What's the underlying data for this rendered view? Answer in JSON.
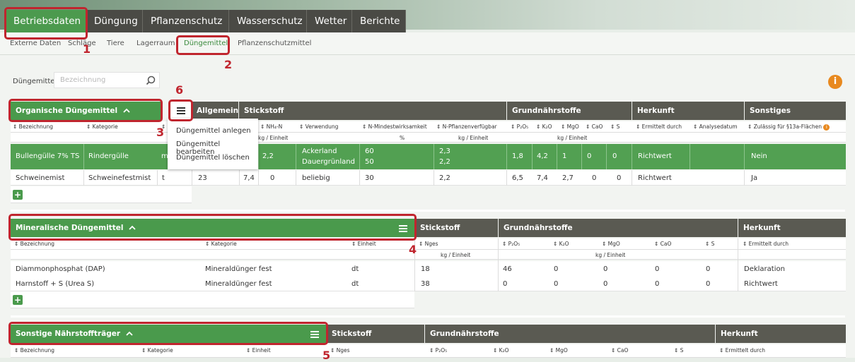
{
  "main_tabs": [
    "Betriebsdaten",
    "Düngung",
    "Pflanzenschutz",
    "Wasserschutz",
    "Wetter",
    "Berichte"
  ],
  "sub_tabs": [
    "Externe Daten",
    "Schläge",
    "Tiere",
    "Lagerraum",
    "Düngemittel",
    "Pflanzenschutzmittel"
  ],
  "search": {
    "label": "Düngemittel",
    "placeholder": "Bezeichnung"
  },
  "info_label": "i",
  "menu": [
    "Düngemittel anlegen",
    "Düngemittel bearbeiten",
    "Düngemittel löschen"
  ],
  "annotations": [
    "1",
    "2",
    "3",
    "4",
    "5",
    "6"
  ],
  "organic": {
    "title": "Organische Düngemittel",
    "groups": [
      "Allgemein",
      "Stickstoff",
      "Grundnährstoffe",
      "Herkunft",
      "Sonstiges"
    ],
    "cols": [
      "Bezeichnung",
      "Kategorie",
      "E",
      "es",
      "NH₄-N",
      "Verwendung",
      "N-Mindestwirksamkeit",
      "N-Pflanzenverfügbar",
      "P₂O₅",
      "K₂O",
      "MgO",
      "CaO",
      "S",
      "Ermittelt durch",
      "Analysedatum",
      "Zulässig für §13a-Flächen"
    ],
    "units": [
      "kg / Einheit",
      "%",
      "kg / Einheit",
      "kg / Einheit"
    ],
    "rows": [
      [
        "Bullengülle 7% TS",
        "Rindergülle",
        "m³",
        "2,2",
        "Ackerland",
        "Dauergrünland",
        "60",
        "50",
        "2,3",
        "2,2",
        "1,8",
        "4,2",
        "1",
        "0",
        "0",
        "Richtwert",
        "Nein"
      ],
      [
        "Schweinemist",
        "Schweinefestmist",
        "t",
        "23",
        "7,4",
        "0",
        "beliebig",
        "30",
        "2,2",
        "6,5",
        "7,4",
        "2,7",
        "0",
        "0",
        "Richtwert",
        "Ja"
      ]
    ]
  },
  "mineral": {
    "title": "Mineralische Düngemittel",
    "groups": [
      "Stickstoff",
      "Grundnährstoffe",
      "Herkunft"
    ],
    "cols": [
      "Bezeichnung",
      "Kategorie",
      "Einheit",
      "Nges",
      "P₂O₅",
      "K₂O",
      "MgO",
      "CaO",
      "S",
      "Ermittelt durch"
    ],
    "units": [
      "kg / Einheit",
      "kg / Einheit"
    ],
    "rows": [
      [
        "Diammonphosphat (DAP)",
        "Mineraldünger fest",
        "dt",
        "18",
        "46",
        "0",
        "0",
        "0",
        "0",
        "Deklaration"
      ],
      [
        "Harnstoff + S (Urea S)",
        "Mineraldünger fest",
        "dt",
        "38",
        "0",
        "0",
        "0",
        "0",
        "0",
        "Richtwert"
      ]
    ]
  },
  "other": {
    "title": "Sonstige Nährstoffträger",
    "groups": [
      "Stickstoff",
      "Grundnährstoffe",
      "Herkunft"
    ],
    "cols": [
      "Bezeichnung",
      "Kategorie",
      "Einheit",
      "Nges",
      "P₂O₅",
      "K₂O",
      "MgO",
      "CaO",
      "S",
      "Ermittelt durch"
    ]
  },
  "colors": {
    "green": "#4a9a4c",
    "dark_header": "#5a5a52",
    "annotation_red": "#c0252e",
    "info_orange": "#e8891f"
  }
}
